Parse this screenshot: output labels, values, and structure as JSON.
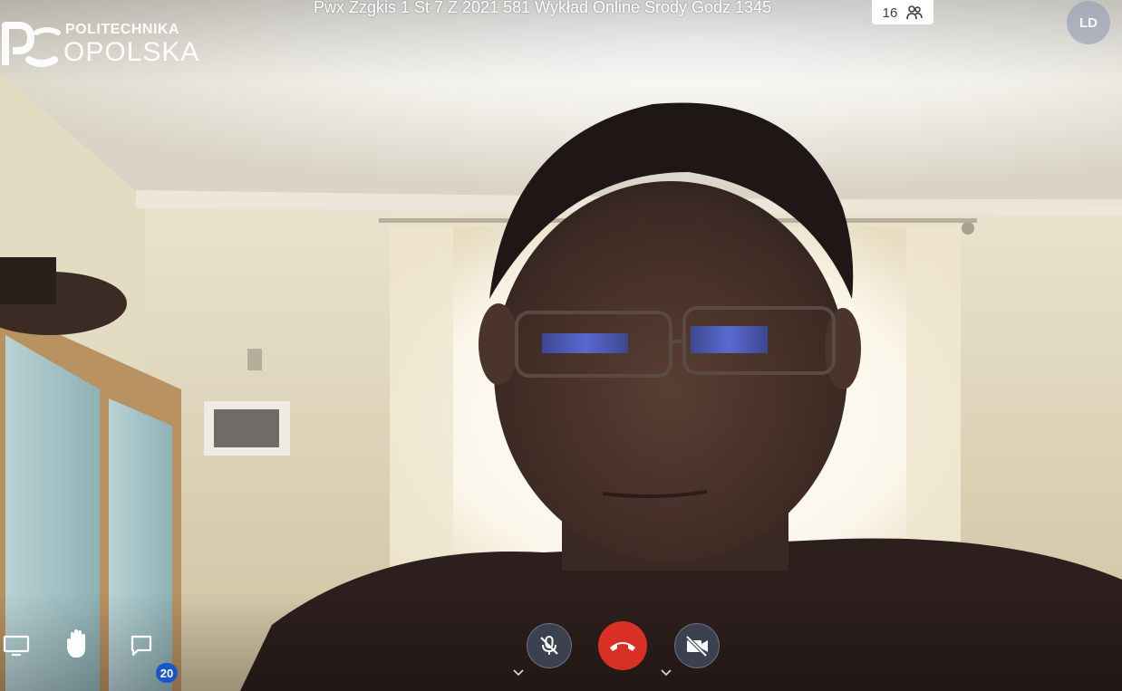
{
  "meeting": {
    "title": "Pwx Zzgkis 1 St 7 Z 2021 581 Wykład Online Srody Godz 1345",
    "participant_count": "16",
    "participants_icon": "people-icon"
  },
  "brand": {
    "logo_icon": "politechnika-logo-icon",
    "line1": "POLITECHNIKA",
    "line2": "OPOLSKA"
  },
  "user": {
    "initials": "LD"
  },
  "toolbar": {
    "share_screen_icon": "monitor-icon",
    "raise_hand_icon": "hand-icon",
    "chat_icon": "chat-bubble-icon",
    "chat_badge": "20",
    "mic_icon": "mic-muted-icon",
    "mic_state": "muted",
    "leave_icon": "phone-hangup-icon",
    "camera_icon": "camera-off-icon",
    "camera_state": "off",
    "options_caret_icon": "chevron-down-icon"
  },
  "colors": {
    "hangup": "#d93025",
    "control_bg": "#3c4150",
    "badge": "#1a56c9",
    "avatar": "#8c96af"
  }
}
